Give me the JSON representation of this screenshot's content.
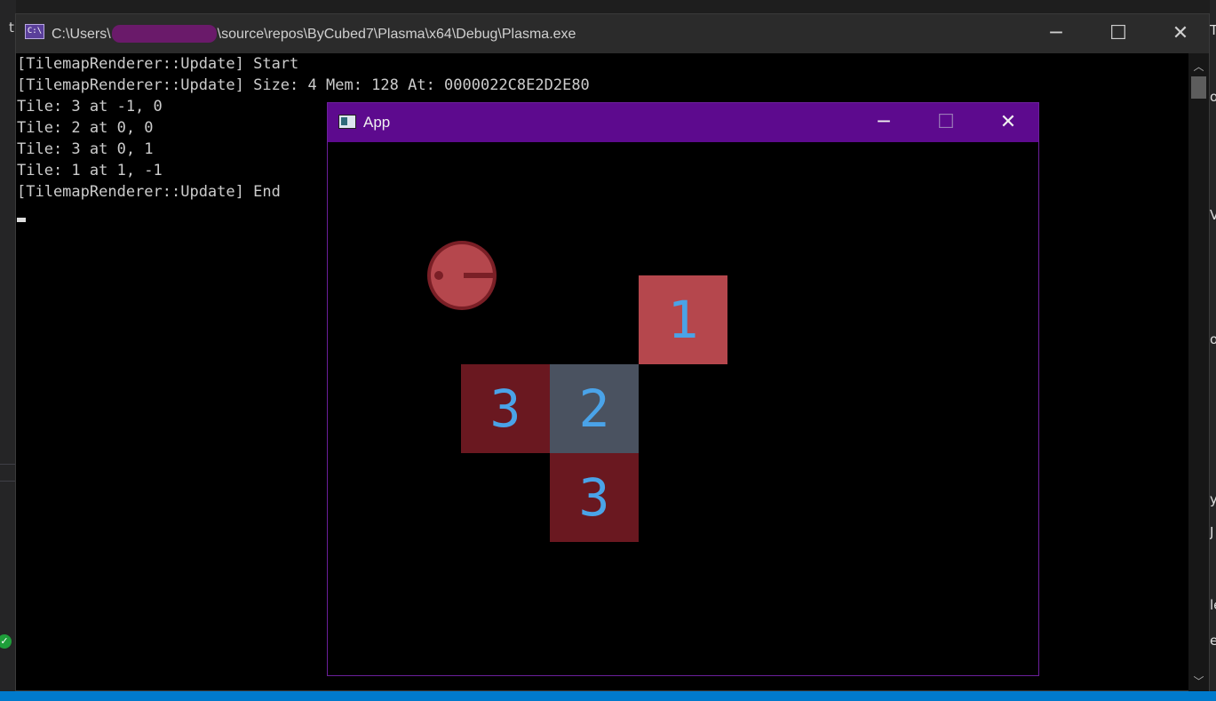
{
  "console": {
    "title_prefix": "C:\\Users\\",
    "title_suffix": "\\source\\repos\\ByCubed7\\Plasma\\x64\\Debug\\Plasma.exe",
    "icon_text": "C:\\",
    "lines": [
      "[TilemapRenderer::Update] Start",
      "[TilemapRenderer::Update] Size: 4 Mem: 128 At: 0000022C8E2D2E80",
      "Tile: 3 at -1, 0",
      "Tile: 2 at 0, 0",
      "Tile: 3 at 0, 1",
      "Tile: 1 at 1, -1",
      "[TilemapRenderer::Update] End"
    ]
  },
  "app": {
    "title": "App",
    "tiles": [
      {
        "label": "3",
        "color": "#6a1820"
      },
      {
        "label": "2",
        "color": "#4a5260"
      },
      {
        "label": "3",
        "color": "#6a1820"
      },
      {
        "label": "1",
        "color": "#b5474d"
      }
    ],
    "player_color": "#b5474d"
  },
  "window_controls": {
    "minimize": "─",
    "maximize": "☐",
    "close": "✕"
  },
  "background": {
    "left_fragment": "t",
    "right_fragments": [
      "T",
      "o",
      "V",
      "o",
      "y",
      "J",
      "le",
      "e"
    ]
  }
}
